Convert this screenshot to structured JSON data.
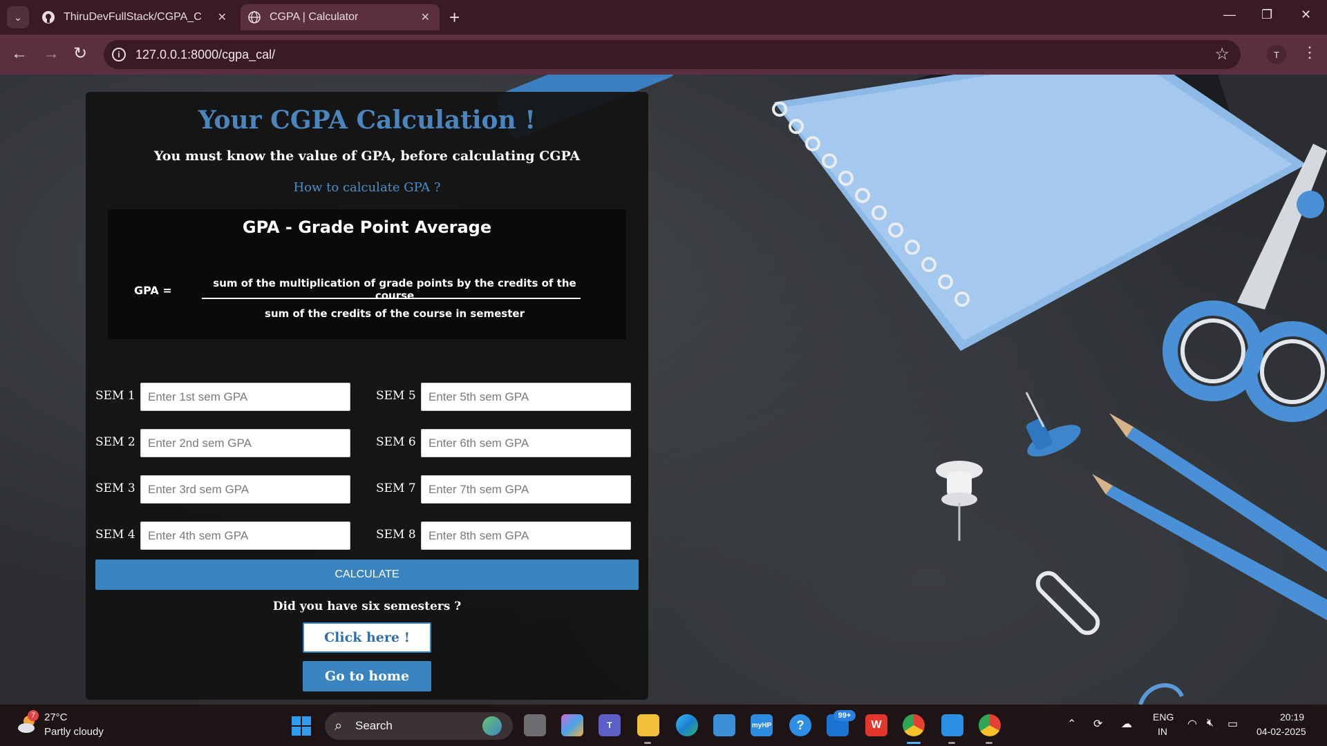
{
  "browser": {
    "tabs": [
      {
        "title": "ThiruDevFullStack/CGPA_Calcul",
        "active": false
      },
      {
        "title": "CGPA | Calculator",
        "active": true
      }
    ],
    "url": "127.0.0.1:8000/cgpa_cal/",
    "profile_initial": "T"
  },
  "page": {
    "title": "Your CGPA Calculation !",
    "subtitle": "You must know the value of GPA, before calculating CGPA",
    "howto_link": "How to calculate GPA ?",
    "formula": {
      "heading": "GPA - Grade  Point Average",
      "lhs": "GPA =",
      "numerator": "sum of the multiplication of grade points by the credits of the course",
      "denominator": "sum of the credits of the course in semester"
    },
    "semesters": [
      {
        "label": "SEM 1",
        "placeholder": "Enter 1st sem GPA"
      },
      {
        "label": "SEM 2",
        "placeholder": "Enter 2nd sem GPA"
      },
      {
        "label": "SEM 3",
        "placeholder": "Enter 3rd sem GPA"
      },
      {
        "label": "SEM 4",
        "placeholder": "Enter 4th sem GPA"
      },
      {
        "label": "SEM 5",
        "placeholder": "Enter 5th sem GPA"
      },
      {
        "label": "SEM 6",
        "placeholder": "Enter 6th sem GPA"
      },
      {
        "label": "SEM 7",
        "placeholder": "Enter 7th sem GPA"
      },
      {
        "label": "SEM 8",
        "placeholder": "Enter 8th sem GPA"
      }
    ],
    "calculate_label": "CALCULATE",
    "six_sem_question": "Did you have six semesters ?",
    "click_here_label": "Click here !",
    "home_label": "Go to home"
  },
  "taskbar": {
    "weather_badge": "7",
    "temperature": "27°C",
    "condition": "Partly cloudy",
    "search_label": "Search",
    "mail_badge": "99+",
    "lang_line1": "ENG",
    "lang_line2": "IN",
    "time": "20:19",
    "date": "04-02-2025"
  },
  "colors": {
    "accent": "#3a85c0",
    "title_blue": "#4a86bd",
    "browser_frame": "#3b1a27",
    "toolbar": "#5a2f3f"
  }
}
